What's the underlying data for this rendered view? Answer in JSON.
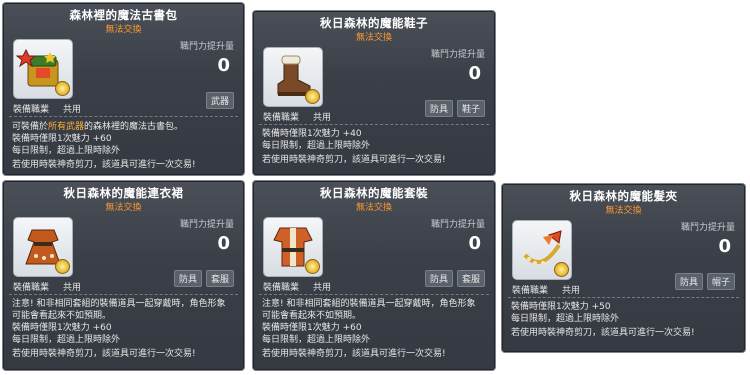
{
  "tooltips": [
    {
      "title": "森林裡的魔法古書包",
      "trade": "無法交換",
      "power_label": "職鬥力提升量",
      "power_value": "0",
      "job_label": "裝備職業",
      "job_value": "共用",
      "badges": [
        "武器"
      ],
      "desc_lines": [
        {
          "pre": "可裝備於",
          "hl": "所有武器",
          "post": "的森林裡的魔法古書包。"
        },
        {
          "pre": "裝備時僅限1次魅力 +60",
          "hl": "",
          "post": ""
        },
        {
          "pre": "每日限制，超過上限時除外",
          "hl": "",
          "post": ""
        },
        {
          "pre": "若使用時裝神奇剪刀，該道具可進行一次交易!",
          "hl": "",
          "post": ""
        }
      ]
    },
    {
      "title": "秋日森林的魔能鞋子",
      "trade": "無法交換",
      "power_label": "職鬥力提升量",
      "power_value": "0",
      "job_label": "裝備職業",
      "job_value": "共用",
      "badges": [
        "防具",
        "鞋子"
      ],
      "desc_lines": [
        {
          "pre": "裝備時僅限1次魅力 +40",
          "hl": "",
          "post": ""
        },
        {
          "pre": "每日限制，超過上限時除外",
          "hl": "",
          "post": ""
        },
        {
          "pre": "若使用時裝神奇剪刀，該道具可進行一次交易!",
          "hl": "",
          "post": ""
        }
      ]
    },
    {
      "title": "秋日森林的魔能連衣裙",
      "trade": "無法交換",
      "power_label": "職鬥力提升量",
      "power_value": "0",
      "job_label": "裝備職業",
      "job_value": "共用",
      "badges": [
        "防具",
        "套服"
      ],
      "desc_lines": [
        {
          "pre": "注意! 和非相同套組的裝備道具一起穿戴時，角色形象",
          "hl": "",
          "post": ""
        },
        {
          "pre": "可能會看起來不如預期。",
          "hl": "",
          "post": ""
        },
        {
          "pre": "裝備時僅限1次魅力 +60",
          "hl": "",
          "post": ""
        },
        {
          "pre": "每日限制，超過上限時除外",
          "hl": "",
          "post": ""
        },
        {
          "pre": "若使用時裝神奇剪刀，該道具可進行一次交易!",
          "hl": "",
          "post": ""
        }
      ]
    },
    {
      "title": "秋日森林的魔能套裝",
      "trade": "無法交換",
      "power_label": "職鬥力提升量",
      "power_value": "0",
      "job_label": "裝備職業",
      "job_value": "共用",
      "badges": [
        "防具",
        "套服"
      ],
      "desc_lines": [
        {
          "pre": "注意! 和非相同套組的裝備道具一起穿戴時，角色形象",
          "hl": "",
          "post": ""
        },
        {
          "pre": "可能會看起來不如預期。",
          "hl": "",
          "post": ""
        },
        {
          "pre": "裝備時僅限1次魅力 +60",
          "hl": "",
          "post": ""
        },
        {
          "pre": "每日限制，超過上限時除外",
          "hl": "",
          "post": ""
        },
        {
          "pre": "若使用時裝神奇剪刀，該道具可進行一次交易!",
          "hl": "",
          "post": ""
        }
      ]
    },
    {
      "title": "秋日森林的魔能髮夾",
      "trade": "無法交換",
      "power_label": "職鬥力提升量",
      "power_value": "0",
      "job_label": "裝備職業",
      "job_value": "共用",
      "badges": [
        "防具",
        "帽子"
      ],
      "desc_lines": [
        {
          "pre": "裝備時僅限1次魅力 +50",
          "hl": "",
          "post": ""
        },
        {
          "pre": "每日限制，超過上限時除外",
          "hl": "",
          "post": ""
        },
        {
          "pre": "若使用時裝神奇剪刀，該道具可進行一次交易!",
          "hl": "",
          "post": ""
        }
      ]
    }
  ],
  "icons": [
    "magic-book-bag-icon",
    "boots-icon",
    "dress-icon",
    "outfit-icon",
    "hairpin-icon"
  ],
  "colors": {
    "accent_orange": "#ff9a2e",
    "highlight": "#ffb13c",
    "panel": "#3b4048"
  }
}
